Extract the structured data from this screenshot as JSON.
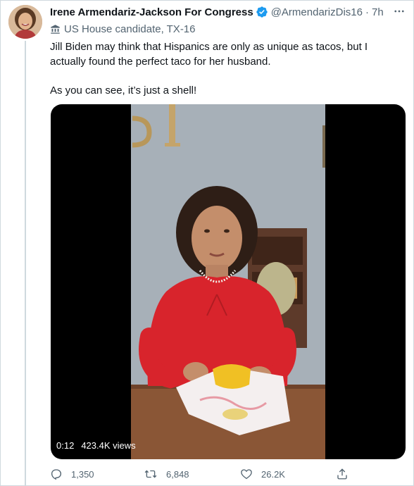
{
  "tweet": {
    "author_name": "Irene Armendariz-Jackson For Congress",
    "handle": "@ArmendarizDis16",
    "separator": "·",
    "time": "7h",
    "label": "US House candidate, TX-16",
    "text_p1": "Jill Biden may think that Hispanics are only as unique as tacos, but I actually found the perfect taco for her husband.",
    "text_p2": "As you can see, it’s just a shell!"
  },
  "video": {
    "duration": "0:12",
    "views": "423.4K views"
  },
  "actions": {
    "replies": "1,350",
    "retweets": "6,848",
    "likes": "26.2K"
  },
  "icons": {
    "more": "more-icon",
    "verified": "verified-badge-icon",
    "label": "government-building-icon",
    "reply": "reply-icon",
    "retweet": "retweet-icon",
    "like": "heart-icon",
    "share": "share-icon"
  },
  "colors": {
    "verified_blue": "#1d9bf0",
    "secondary_text": "#536471",
    "primary_text": "#0f1419"
  }
}
